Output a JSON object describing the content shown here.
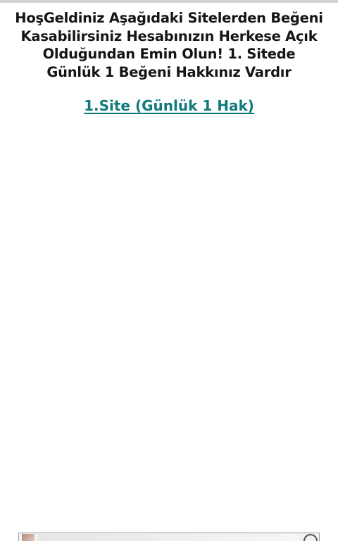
{
  "heading": "HoşGeldiniz Aşağıdaki Sitelerden Beğeni Kasabilirsiniz Hesabınızın Herkese Açık Olduğundan Emin Olun! 1. Sitede Günlük 1 Beğeni Hakkınız Vardır",
  "links": [
    {
      "label": "1.Site (Günlük 1 Hak)"
    }
  ],
  "colors": {
    "link": "#0f7a7a",
    "heading_text": "#151515",
    "background": "#ffffff"
  },
  "icons": {
    "ad_close": "close-circle-icon"
  }
}
